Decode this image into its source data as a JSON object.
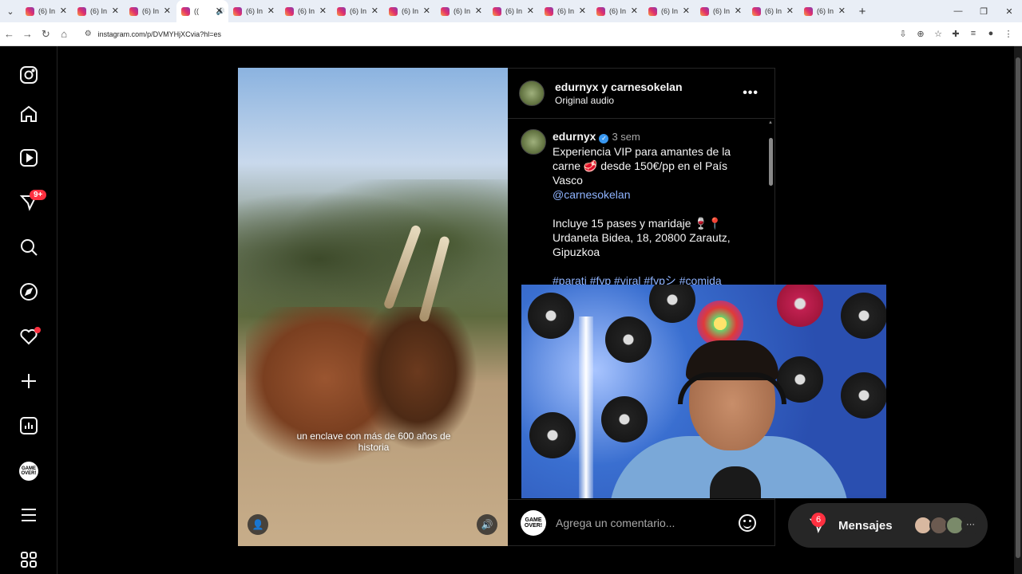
{
  "browser": {
    "tabs": [
      {
        "label": "(6) In"
      },
      {
        "label": "(6) In"
      },
      {
        "label": "(6) In"
      },
      {
        "label": "(("
      },
      {
        "label": "(6) In"
      },
      {
        "label": "(6) In"
      },
      {
        "label": "(6) In"
      },
      {
        "label": "(6) In"
      },
      {
        "label": "(6) In"
      },
      {
        "label": "(6) In"
      },
      {
        "label": "(6) In"
      },
      {
        "label": "(6) In"
      },
      {
        "label": "(6) In"
      },
      {
        "label": "(6) In"
      },
      {
        "label": "(6) In"
      },
      {
        "label": "(6) In"
      }
    ],
    "url": "instagram.com/p/DVMYHjXCvia?hl=es"
  },
  "sidebar": {
    "notifications_badge": "9+",
    "profile_initials": "GAME OVER!"
  },
  "post": {
    "header_user": "edurnyx y carnesokelan",
    "header_audio": "Original audio",
    "more_label": "•••",
    "video_caption": "un enclave con más de 600 años de historia",
    "comment": {
      "user": "edurnyx",
      "verified_mark": "✓",
      "time": "3 sem",
      "line1": "Experiencia VIP para amantes de la carne 🥩 desde 150€/pp en el País Vasco",
      "mention": "@carnesokelan",
      "line2": "Incluye 15 pases y maridaje 🍷📍 Urdaneta Bidea, 18, 20800 Zarautz, Gipuzkoa",
      "tags": "#parati #fyp #viral #fypシ #comida"
    },
    "comment_placeholder": "Agrega un comentario...",
    "commenter_avatar": "GAME OVER!"
  },
  "messages": {
    "label": "Mensajes",
    "badge": "6",
    "more": "···"
  }
}
